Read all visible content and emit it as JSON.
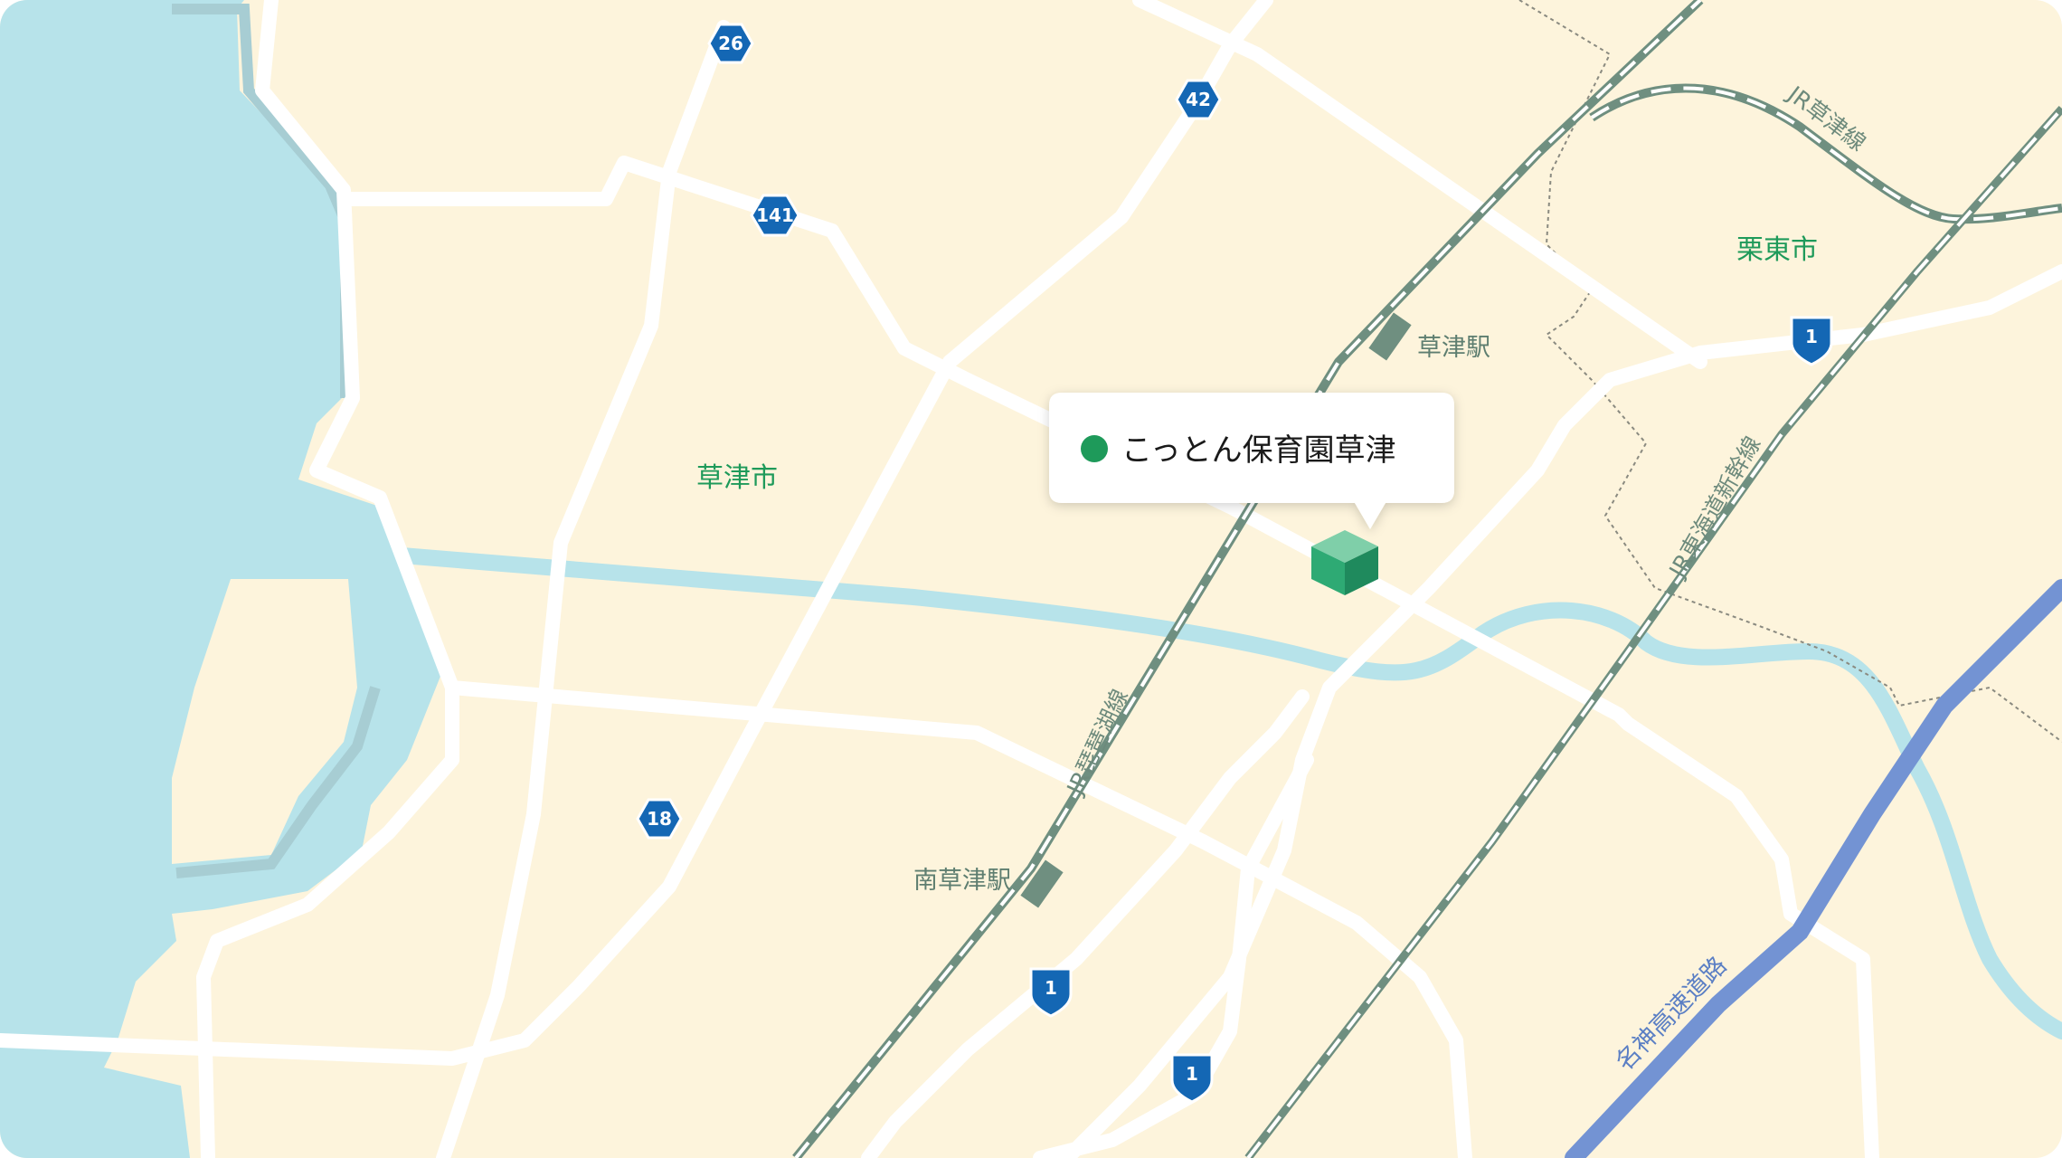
{
  "map": {
    "colors": {
      "land": "#fdf4dc",
      "water": "#b7e3ea",
      "road": "#ffffff",
      "rail": "#6f8f80",
      "shinkansen": "#6f8f80",
      "expressway": "#7393d3",
      "city_label": "#1e9a5a",
      "shield": "#1467b4",
      "marker": "#1e9a5a",
      "building": "#2eaa74"
    },
    "cities": {
      "kusatsu": "草津市",
      "ritto": "栗東市"
    },
    "stations": {
      "kusatsu": "草津駅",
      "minami_kusatsu": "南草津駅"
    },
    "rail_lines": {
      "biwako": "JR琵琶湖線",
      "kusatsu": "JR草津線",
      "tokaido_shinkansen": "JR東海道新幹線"
    },
    "expressway": "名神高速道路",
    "route_shields": {
      "r26": "26",
      "r42": "42",
      "r141": "141",
      "r18": "18",
      "r1_east": "1",
      "r1_south_a": "1",
      "r1_south_b": "1"
    },
    "callout": {
      "name": "こっとん保育園草津"
    }
  }
}
